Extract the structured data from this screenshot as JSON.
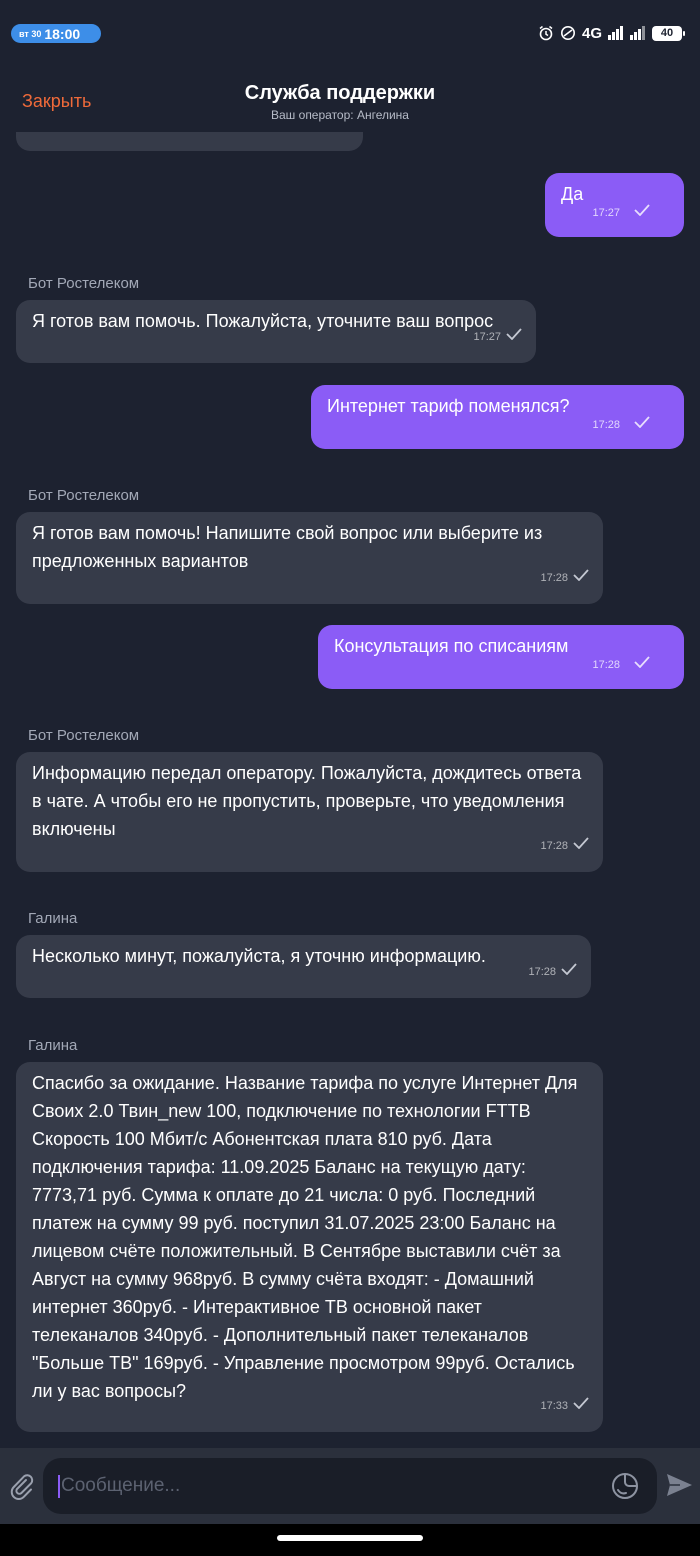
{
  "status_bar": {
    "date": "вт 30",
    "time": "18:00",
    "network": "4G",
    "battery": "40",
    "icons": [
      "alarm-icon",
      "dnd-icon",
      "signal-icon",
      "signal-icon",
      "battery-icon"
    ]
  },
  "header": {
    "close_label": "Закрыть",
    "title": "Служба поддержки",
    "subtitle": "Ваш оператор: Ангелина"
  },
  "messages": [
    {
      "direction": "out",
      "text": "Да",
      "time": "17:27"
    },
    {
      "direction": "in",
      "sender": "Бот Ростелеком",
      "text": "Я готов вам помочь. Пожалуйста, уточните ваш вопрос",
      "time": "17:27"
    },
    {
      "direction": "out",
      "text": "Интернет тариф поменялся?",
      "time": "17:28"
    },
    {
      "direction": "in",
      "sender": "Бот Ростелеком",
      "text": "Я готов вам помочь! Напишите свой вопрос или выберите из предложенных вариантов",
      "time": "17:28"
    },
    {
      "direction": "out",
      "text": "Консультация по списаниям",
      "time": "17:28"
    },
    {
      "direction": "in",
      "sender": "Бот Ростелеком",
      "text": "Информацию передал оператору. Пожалуйста, дождитесь ответа в чате. А чтобы его не пропустить, проверьте, что уведомления включены",
      "time": "17:28"
    },
    {
      "direction": "in",
      "sender": "Галина",
      "text": "Несколько минут, пожалуйста, я уточню информацию.",
      "time": "17:28"
    },
    {
      "direction": "in",
      "sender": "Галина",
      "text": "Спасибо за ожидание. Название тарифа по услуге Интернет Для Своих 2.0 Твин_new 100, подключение по технологии FTTB Скорость 100 Мбит/с Абонентская плата 810 руб. Дата подключения тарифа: 11.09.2025 Баланс на текущую дату: 7773,71 руб. Сумма к оплате до 21 числа: 0 руб. Последний платеж на сумму 99 руб. поступил 31.07.2025 23:00 Баланс на лицевом счёте положительный. В Сентябре выставили счёт за Август на сумму 968руб. В сумму счёта входят: - Домашний интернет 360руб. - Интерактивное ТВ основной пакет телеканалов 340руб. - Дополнительный пакет телеканалов \"Больше ТВ\" 169руб. - Управление просмотром 99руб. Остались ли у вас вопросы?",
      "time": "17:33"
    }
  ],
  "composer": {
    "placeholder": "Сообщение..."
  },
  "colors": {
    "background": "#1d2230",
    "incoming_bubble": "#363b49",
    "outgoing_bubble": "#8b5cf6",
    "close_accent": "#ef6a3a"
  }
}
